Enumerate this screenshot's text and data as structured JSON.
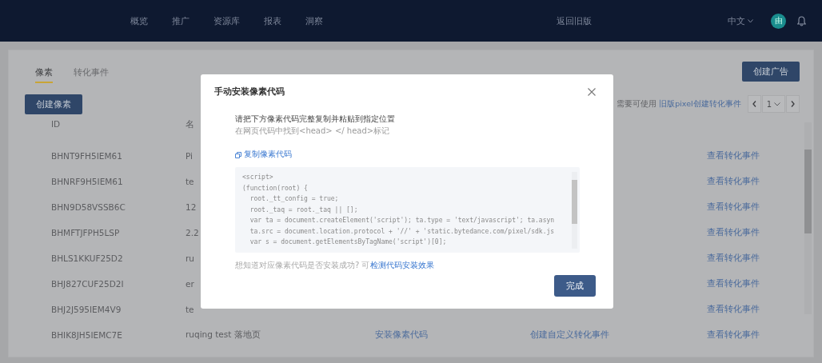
{
  "nav": {
    "items": [
      {
        "label": "概览"
      },
      {
        "label": "推广"
      },
      {
        "label": "资源库"
      },
      {
        "label": "报表"
      },
      {
        "label": "洞察"
      }
    ],
    "old_version_link": "返回旧版",
    "language": "中文",
    "avatar": "由"
  },
  "tabs": [
    {
      "label": "像素",
      "selected": true
    },
    {
      "label": "转化事件",
      "selected": false
    }
  ],
  "create_ad_button": "创建广告",
  "create_pixel_button": "创建像素",
  "notice": {
    "text": "需要可使用",
    "link": "旧版pixel创建转化事件"
  },
  "pagination": {
    "page": "1"
  },
  "table": {
    "columns": [
      "ID",
      "名"
    ],
    "rows": [
      {
        "id": "BHNT9FH5IEM61",
        "name": "Pi",
        "view": "查看转化事件"
      },
      {
        "id": "BHNRF9H5IEM61",
        "name": "te",
        "view": "查看转化事件"
      },
      {
        "id": "BHN9D58VSSB6C",
        "name": "12",
        "view": "查看转化事件"
      },
      {
        "id": "BHMFTJFPH5LSP",
        "name": "2.2",
        "view": "查看转化事件"
      },
      {
        "id": "BHLS1KKUF25D2",
        "name": "ru",
        "view": "查看转化事件"
      },
      {
        "id": "BHJ827CUF25D2I",
        "name": "er",
        "view": "查看转化事件"
      },
      {
        "id": "BHJ2J595IEM4V9",
        "name": "te",
        "view": "查看转化事件"
      },
      {
        "id": "BHIK8JH5IEMC7E",
        "name": "ruqing test 落地页",
        "install": "安装像素代码",
        "custom": "创建自定义转化事件",
        "view": "查看转化事件"
      }
    ]
  },
  "modal": {
    "title": "手动安装像素代码",
    "instruction": "请把下方像素代码完整复制并粘贴到指定位置",
    "hint": "在网页代码中找到<head> </ head>标记",
    "copy_link": "复制像素代码",
    "code": [
      "<script>",
      "(function(root) {",
      "  root._tt_config = true;",
      "  root._taq = root._taq || [];",
      "  var ta = document.createElement('script'); ta.type = 'text/javascript'; ta.asyn",
      "  ta.src = document.location.protocol + '//' + 'static.bytedance.com/pixel/sdk.js",
      "  var s = document.getElementsByTagName('script')[0];"
    ],
    "footer": {
      "text": "想知道对应像素代码是否安装成功? 可",
      "link": "检测代码安装效果"
    },
    "done_button": "完成"
  }
}
